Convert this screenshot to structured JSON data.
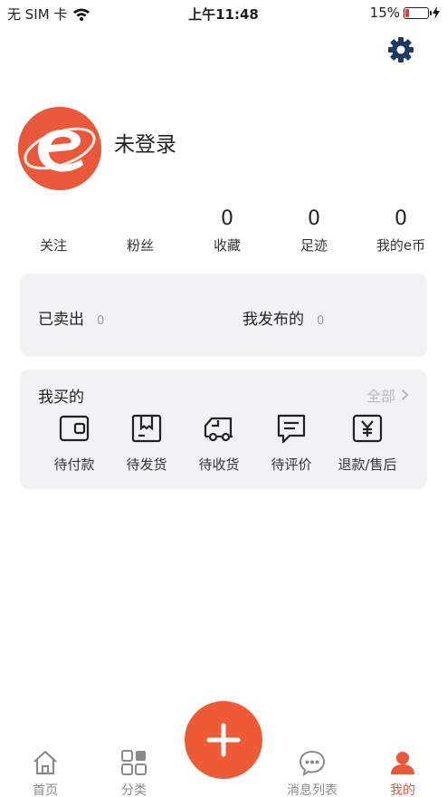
{
  "status_bar": {
    "carrier": "无 SIM 卡",
    "time": "上午11:48",
    "battery_percent": "15%",
    "battery_level": 0.15,
    "wifi_icon": "wifi-icon"
  },
  "header": {
    "settings_icon": "gear-icon"
  },
  "profile": {
    "name": "未登录",
    "avatar_icon": "e-logo"
  },
  "stats": [
    {
      "label": "关注",
      "value": ""
    },
    {
      "label": "粉丝",
      "value": ""
    },
    {
      "label": "收藏",
      "value": "0"
    },
    {
      "label": "足迹",
      "value": "0"
    },
    {
      "label": "我的e币",
      "value": "0"
    }
  ],
  "sales": {
    "sold_label": "已卖出",
    "sold_count": "0",
    "published_label": "我发布的",
    "published_count": "0"
  },
  "purchases": {
    "title": "我买的",
    "all_label": "全部",
    "items": [
      {
        "label": "待付款",
        "icon": "wallet-icon"
      },
      {
        "label": "待发货",
        "icon": "package-icon"
      },
      {
        "label": "待收货",
        "icon": "truck-icon"
      },
      {
        "label": "待评价",
        "icon": "comment-icon"
      },
      {
        "label": "退款/售后",
        "icon": "refund-icon"
      }
    ]
  },
  "tabbar": {
    "items": [
      {
        "label": "首页",
        "icon": "home-icon",
        "active": false
      },
      {
        "label": "分类",
        "icon": "grid-icon",
        "active": false
      },
      {
        "label": "消息列表",
        "icon": "chat-icon",
        "active": false
      },
      {
        "label": "我的",
        "icon": "user-icon",
        "active": true
      }
    ],
    "publish_icon": "plus-icon"
  },
  "colors": {
    "accent": "#ee5936",
    "card_bg": "#f2f2f4",
    "muted": "#9a9a9a"
  }
}
